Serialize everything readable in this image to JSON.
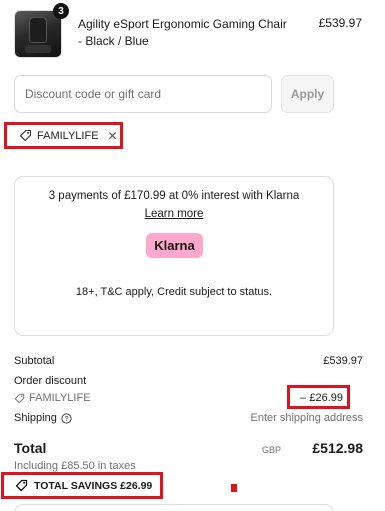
{
  "product": {
    "quantity": "3",
    "name": "Agility eSport Ergonomic Gaming Chair - Black / Blue",
    "price": "£539.97"
  },
  "discount": {
    "placeholder": "Discount code or gift card",
    "apply_label": "Apply",
    "applied_code": "FAMILYLIFE",
    "remove_symbol": "✕"
  },
  "klarna": {
    "offer_text": "3 payments of £170.99 at 0% interest with Klarna",
    "learn_more": "Learn more",
    "logo_text": "Klarna",
    "terms": "18+, T&C apply, Credit subject to status."
  },
  "summary": {
    "subtotal_label": "Subtotal",
    "subtotal_value": "£539.97",
    "order_discount_label": "Order discount",
    "discount_code": "FAMILYLIFE",
    "discount_value": "– £26.99",
    "shipping_label": "Shipping",
    "shipping_value": "Enter shipping address",
    "total_label": "Total",
    "currency": "GBP",
    "total_value": "£512.98",
    "taxes_text": "Including £85.50 in taxes",
    "total_savings": "TOTAL SAVINGS £26.99"
  },
  "colors": {
    "highlight": "#e0121b",
    "klarna_pink": "#ffa8cd"
  }
}
